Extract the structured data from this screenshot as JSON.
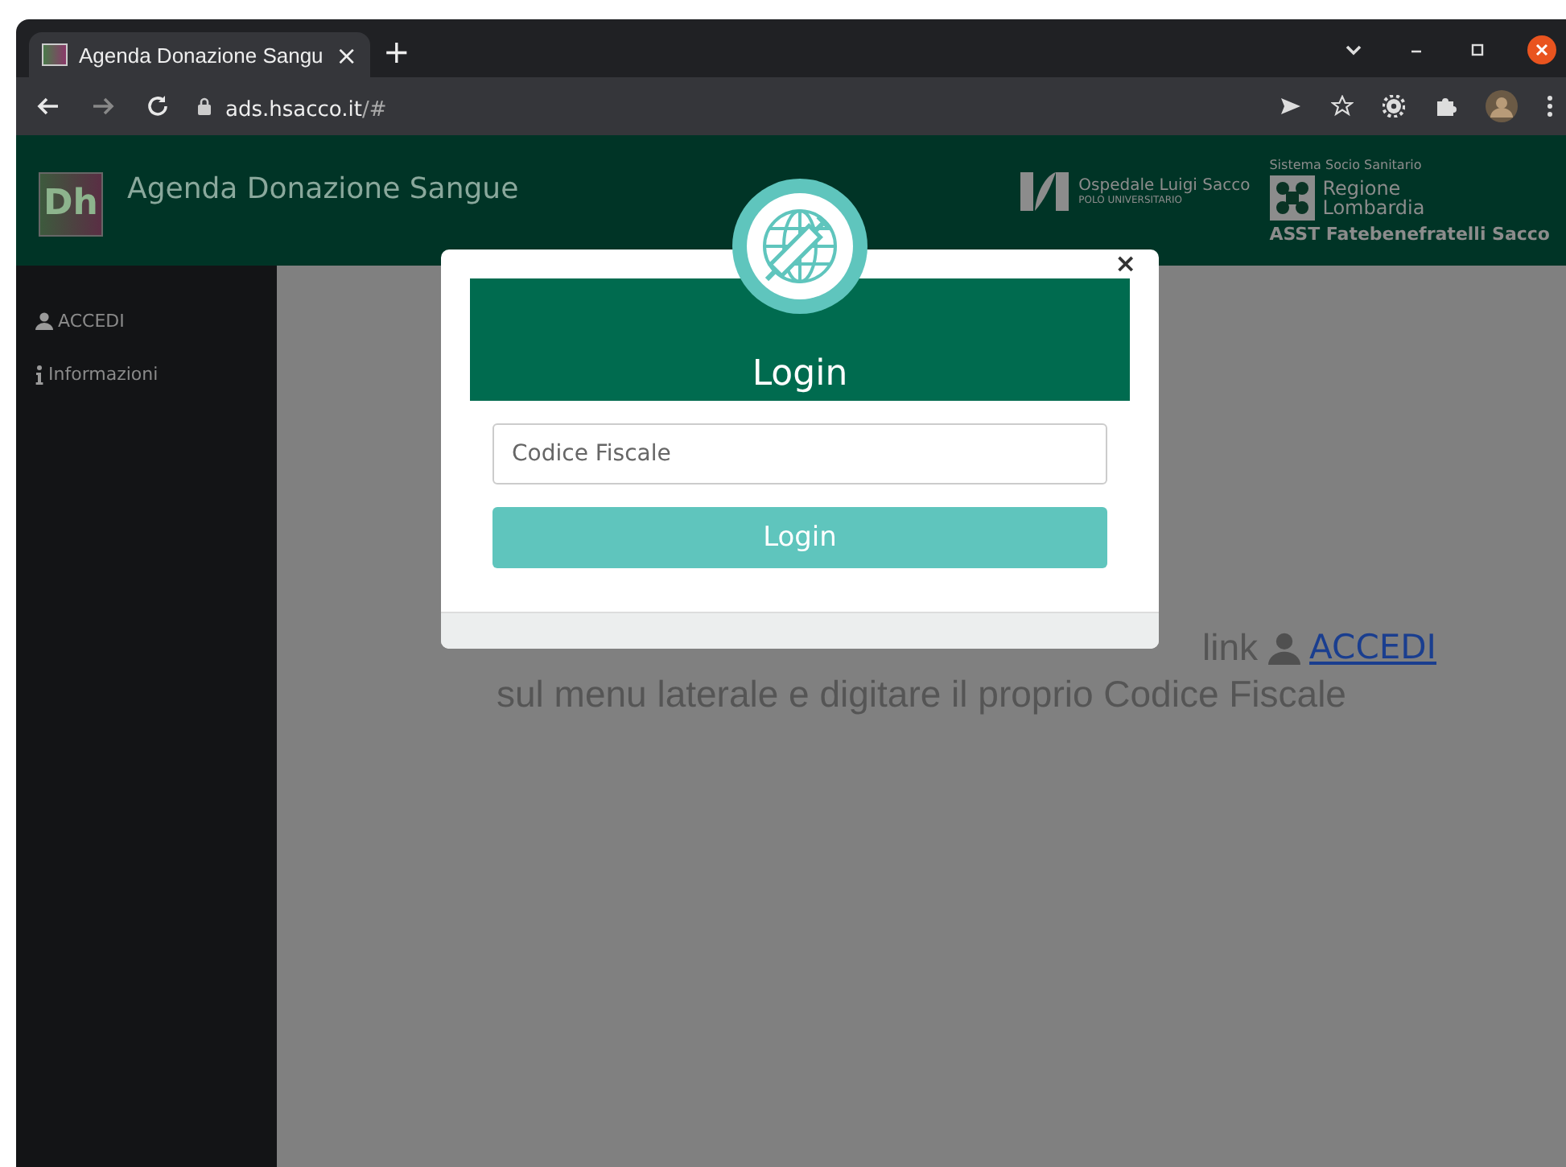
{
  "browser": {
    "tab_title": "Agenda Donazione Sangu",
    "tab_close": "×",
    "new_tab": "+",
    "url_host": "ads.hsacco.it",
    "url_path": "/#"
  },
  "header": {
    "logo": "Dh",
    "title": "Agenda Donazione Sangue",
    "hospital_name": "Ospedale Luigi Sacco",
    "hospital_sub": "POLO UNIVERSITARIO",
    "region_caption": "Sistema Socio Sanitario",
    "region_line1": "Regione",
    "region_line2": "Lombardia",
    "asst": "ASST Fatebenefratelli Sacco"
  },
  "sidebar": {
    "items": [
      {
        "kind": "user",
        "label": "ACCEDI"
      },
      {
        "kind": "info",
        "label": "Informazioni"
      }
    ]
  },
  "main": {
    "line1": "link",
    "link": "ACCEDI",
    "line2": "sul menu laterale e digitare il proprio Codice Fiscale"
  },
  "modal": {
    "close": "×",
    "title": "Login",
    "placeholder": "Codice Fiscale",
    "button": "Login"
  }
}
